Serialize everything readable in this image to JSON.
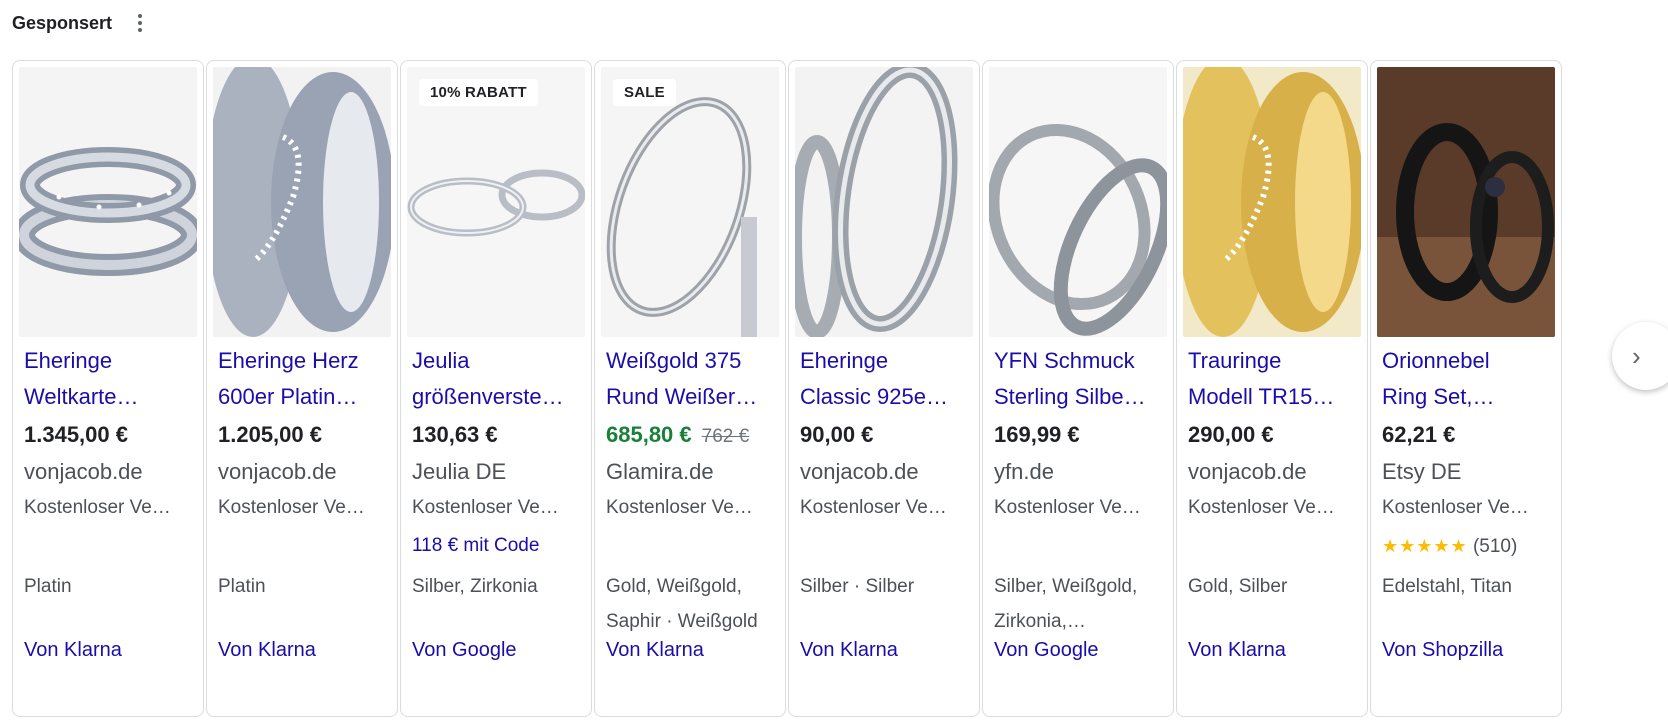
{
  "header": {
    "title": "Gesponsert",
    "menu_icon": "more-vert-icon"
  },
  "products": [
    {
      "title_l1": "Eheringe",
      "title_l2": "Weltkarte…",
      "price": "1.345,00 €",
      "store": "vonjacob.de",
      "shipping": "Kostenloser Ve…",
      "attrs_l1": "Platin",
      "source": "Von Klarna",
      "image": "silver-ring-pair-world-map"
    },
    {
      "title_l1": "Eheringe Herz",
      "title_l2": "600er Platin…",
      "price": "1.205,00 €",
      "store": "vonjacob.de",
      "shipping": "Kostenloser Ve…",
      "attrs_l1": "Platin",
      "source": "Von Klarna",
      "image": "platinum-ring-pair-heart"
    },
    {
      "badge": "10% RABATT",
      "title_l1": "Jeulia",
      "title_l2": "größenverste…",
      "price": "130,63 €",
      "store": "Jeulia DE",
      "shipping": "Kostenloser Ve…",
      "promo": "118 € mit Code",
      "attrs_l1": "Silber, Zirkonia",
      "source": "Von Google",
      "image": "silver-ring-pair-flat"
    },
    {
      "badge": "SALE",
      "title_l1": "Weißgold 375",
      "title_l2": "Rund Weißer…",
      "price": "685,80 €",
      "old_price": "762 €",
      "store": "Glamira.de",
      "shipping": "Kostenloser Ve…",
      "attrs_l1": "Gold, Weißgold,",
      "attrs_l2": "Saphir · Weißgold",
      "source": "Von Klarna",
      "image": "white-gold-ring-pair"
    },
    {
      "title_l1": "Eheringe",
      "title_l2": "Classic 925e…",
      "price": "90,00 €",
      "store": "vonjacob.de",
      "shipping": "Kostenloser Ve…",
      "attrs_l1": "Silber · Silber",
      "source": "Von Klarna",
      "image": "silver-classic-rings"
    },
    {
      "title_l1": "YFN Schmuck",
      "title_l2": "Sterling Silbe…",
      "price": "169,99 €",
      "store": "yfn.de",
      "shipping": "Kostenloser Ve…",
      "attrs_l1": "Silber, Weißgold,",
      "attrs_l2": "Zirkonia,…",
      "source": "Von Google",
      "image": "engraved-silver-rings"
    },
    {
      "title_l1": "Trauringe",
      "title_l2": "Modell TR15…",
      "price": "290,00 €",
      "store": "vonjacob.de",
      "shipping": "Kostenloser Ve…",
      "attrs_l1": "Gold, Silber",
      "source": "Von Klarna",
      "image": "gold-ring-pair-heart"
    },
    {
      "title_l1": "Orionnebel",
      "title_l2": "Ring Set,…",
      "price": "62,21 €",
      "store": "Etsy DE",
      "shipping": "Kostenloser Ve…",
      "rating_stars": "★★★★★",
      "rating_count": "(510)",
      "rating_value": 5,
      "attrs_l1": "Edelstahl, Titan",
      "source": "Von Shopzilla",
      "image": "black-ring-set"
    }
  ],
  "colors": {
    "link": "#1a0dab",
    "sale_price": "#188038",
    "star": "#fbbc04"
  },
  "next_icon": "chevron-right-icon",
  "next_glyph": "›"
}
